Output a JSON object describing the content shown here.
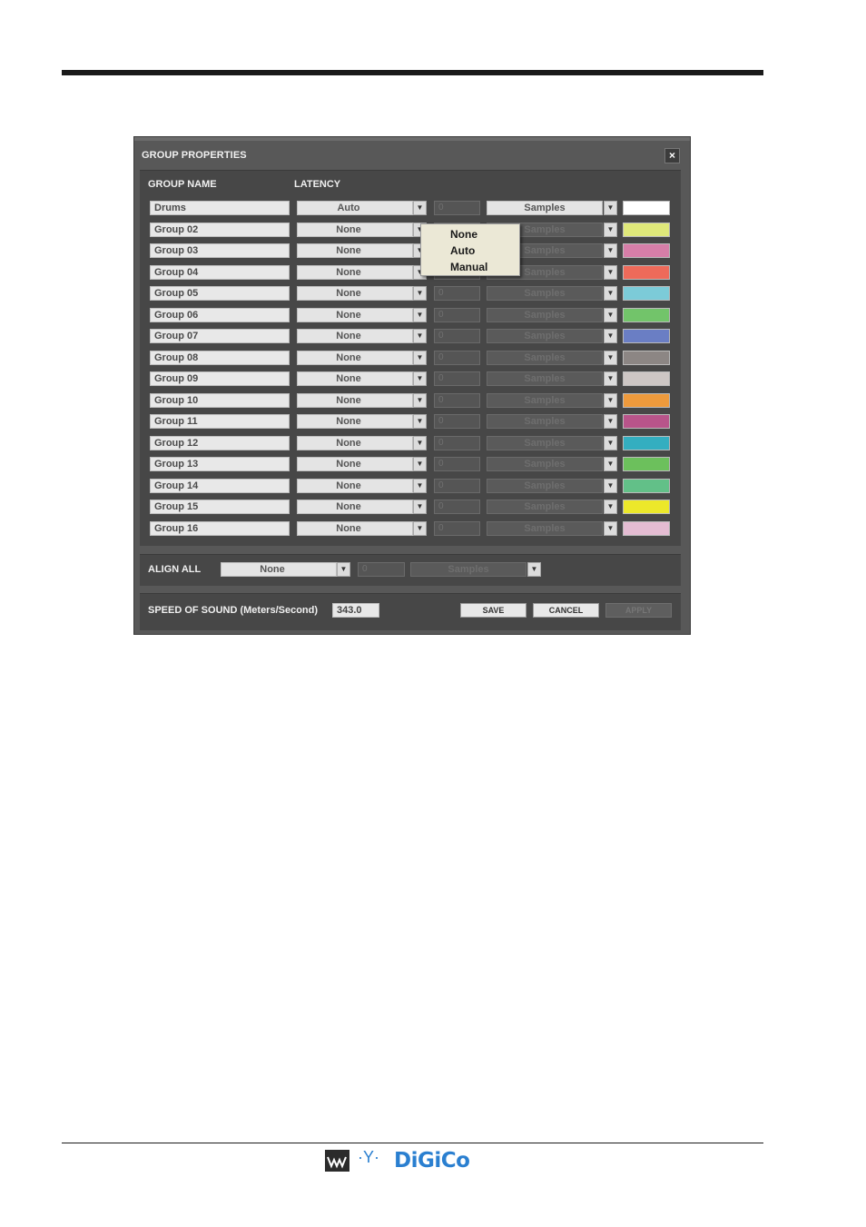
{
  "dialog": {
    "title": "GROUP PROPERTIES",
    "close_label": "×",
    "headers": {
      "group_name": "GROUP NAME",
      "latency": "LATENCY"
    }
  },
  "groups": [
    {
      "name": "Drums",
      "latency": "Auto",
      "value": "0",
      "unit": "Samples",
      "color": "#ffffff",
      "unit_active": true
    },
    {
      "name": "Group 02",
      "latency": "None",
      "value": "0",
      "unit": "Samples",
      "color": "#dfe87a"
    },
    {
      "name": "Group 03",
      "latency": "None",
      "value": "0",
      "unit": "Samples",
      "color": "#d67ea8"
    },
    {
      "name": "Group 04",
      "latency": "None",
      "value": "0",
      "unit": "Samples",
      "color": "#ee6a5a"
    },
    {
      "name": "Group 05",
      "latency": "None",
      "value": "0",
      "unit": "Samples",
      "color": "#7ccbd8"
    },
    {
      "name": "Group 06",
      "latency": "None",
      "value": "0",
      "unit": "Samples",
      "color": "#72c46a"
    },
    {
      "name": "Group 07",
      "latency": "None",
      "value": "0",
      "unit": "Samples",
      "color": "#6a7ec4"
    },
    {
      "name": "Group 08",
      "latency": "None",
      "value": "0",
      "unit": "Samples",
      "color": "#8c8684"
    },
    {
      "name": "Group 09",
      "latency": "None",
      "value": "0",
      "unit": "Samples",
      "color": "#cdc6c4"
    },
    {
      "name": "Group 10",
      "latency": "None",
      "value": "0",
      "unit": "Samples",
      "color": "#ee9a3c"
    },
    {
      "name": "Group 11",
      "latency": "None",
      "value": "0",
      "unit": "Samples",
      "color": "#b8548a"
    },
    {
      "name": "Group 12",
      "latency": "None",
      "value": "0",
      "unit": "Samples",
      "color": "#34aec0"
    },
    {
      "name": "Group 13",
      "latency": "None",
      "value": "0",
      "unit": "Samples",
      "color": "#6cc05c"
    },
    {
      "name": "Group 14",
      "latency": "None",
      "value": "0",
      "unit": "Samples",
      "color": "#62c088"
    },
    {
      "name": "Group 15",
      "latency": "None",
      "value": "0",
      "unit": "Samples",
      "color": "#ece82a"
    },
    {
      "name": "Group 16",
      "latency": "None",
      "value": "0",
      "unit": "Samples",
      "color": "#e4bcd2"
    }
  ],
  "dropdown": {
    "options": [
      "None",
      "Auto",
      "Manual"
    ]
  },
  "align_all": {
    "label": "ALIGN ALL",
    "latency": "None",
    "value": "0",
    "unit": "Samples"
  },
  "speed": {
    "label": "SPEED OF SOUND (Meters/Second)",
    "value": "343.0"
  },
  "buttons": {
    "save": "SAVE",
    "cancel": "CANCEL",
    "apply": "APPLY"
  },
  "footer": {
    "logo_text": "DiGiCo",
    "logo_icon": "waves-logo-icon",
    "accent_color": "#2a7fd0"
  }
}
